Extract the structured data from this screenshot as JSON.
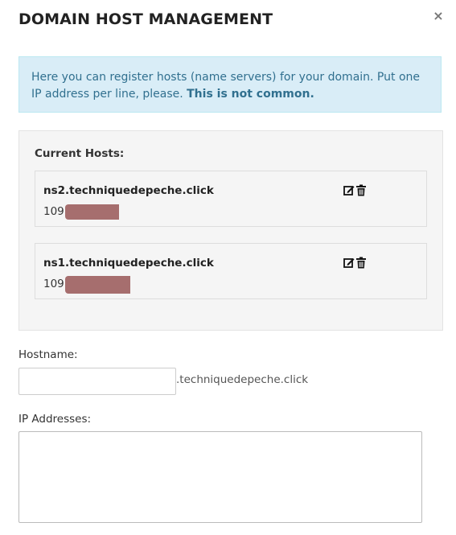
{
  "modal": {
    "title": "DOMAIN HOST MANAGEMENT",
    "close_label": "×"
  },
  "info": {
    "text": "Here you can register hosts (name servers) for your domain. Put one IP address per line, please. ",
    "emphasis": "This is not common."
  },
  "hosts": {
    "label": "Current Hosts:",
    "items": [
      {
        "name": "ns2.techniquedepeche.click",
        "ip_visible": "109.",
        "ip_redacted": true
      },
      {
        "name": "ns1.techniquedepeche.click",
        "ip_visible": "109.",
        "ip_redacted": true
      }
    ],
    "icons": {
      "edit": "edit-icon",
      "delete": "trash-icon"
    }
  },
  "form": {
    "hostname_label": "Hostname:",
    "hostname_value": "",
    "domain_suffix": ".techniquedepeche.click",
    "ip_label": "IP Addresses:",
    "ip_value": ""
  },
  "colors": {
    "info_bg": "#d9edf7",
    "info_text": "#31708f",
    "well_bg": "#f5f5f5",
    "redaction": "#a66e6e"
  }
}
